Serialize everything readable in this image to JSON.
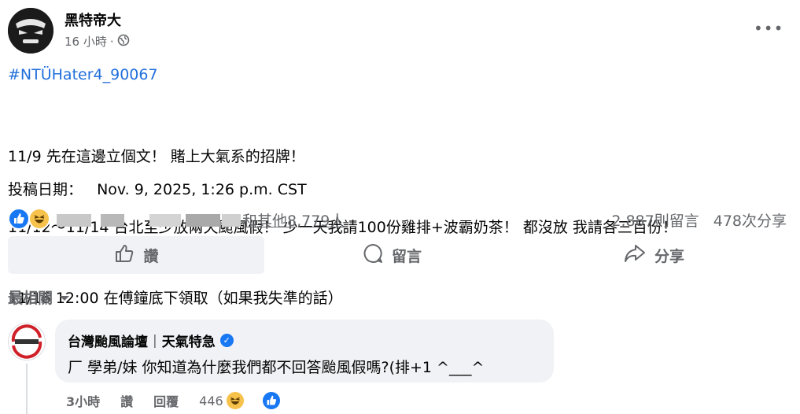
{
  "post": {
    "author": "黑特帝大",
    "time": "16 小時",
    "dot": "·",
    "hashtag": "#NTÜHater4_90067",
    "lines": [
      "11/9 先在這邊立個文！ 賭上大氣系的招牌！",
      "11/12〜11/14 台北至少放兩天颱風假！ 少一天我請100份雞排+波霸奶茶！ 都沒放 我請各三百份！",
      "11/16 12:00 在傅鐘底下領取（如果我失準的話）"
    ],
    "date_label": "投稿日期：",
    "date_value": "Nov. 9, 2025, 1:26 p.m. CST",
    "more_icon": "more-horizontal-icon",
    "privacy_icon": "globe-icon"
  },
  "reactions": {
    "others_text": "和其他8,779人",
    "comments": "2,887則留言",
    "shares": "478次分享",
    "icons": [
      "like-reaction-icon",
      "haha-reaction-icon"
    ]
  },
  "actions": {
    "like": "讚",
    "comment": "留言",
    "share": "分享"
  },
  "comments_section": {
    "sort_label": "最相關",
    "comment": {
      "author": "台灣颱風論壇",
      "separator": "|",
      "author_suffix": "天氣特急",
      "text": "厂 學弟/妹 你知道為什麼我們都不回答颱風假嗎?(排+1 ^___^",
      "time": "3小時",
      "like_label": "讚",
      "reply_label": "回覆",
      "reaction_count": "446"
    }
  },
  "colors": {
    "link_blue": "#216fdb",
    "facebook_blue": "#1877f2",
    "secondary_text": "#65676b",
    "bubble_bg": "#f0f2f5"
  }
}
